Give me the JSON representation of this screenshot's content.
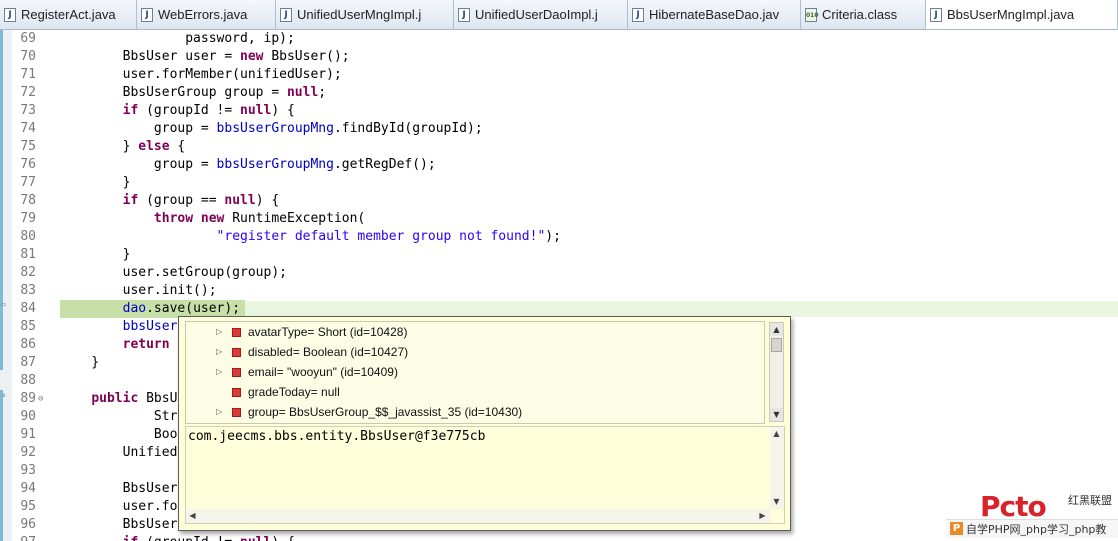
{
  "tabs": [
    {
      "label": "RegisterAct.java",
      "icon": "J",
      "active": false
    },
    {
      "label": "WebErrors.java",
      "icon": "J",
      "active": false
    },
    {
      "label": "UnifiedUserMngImpl.j",
      "icon": "J",
      "active": false
    },
    {
      "label": "UnifiedUserDaoImpl.j",
      "icon": "J",
      "active": false
    },
    {
      "label": "HibernateBaseDao.jav",
      "icon": "J",
      "active": false
    },
    {
      "label": "Criteria.class",
      "icon": "010",
      "active": false
    },
    {
      "label": "BbsUserMngImpl.java",
      "icon": "J",
      "active": true
    }
  ],
  "code_lines": [
    {
      "num": "69",
      "text": "                password, ip);"
    },
    {
      "num": "70",
      "text": "        BbsUser user = new BbsUser();"
    },
    {
      "num": "71",
      "text": "        user.forMember(unifiedUser);"
    },
    {
      "num": "72",
      "text": "        BbsUserGroup group = null;"
    },
    {
      "num": "73",
      "text": "        if (groupId != null) {"
    },
    {
      "num": "74",
      "text": "            group = bbsUserGroupMng.findById(groupId);"
    },
    {
      "num": "75",
      "text": "        } else {"
    },
    {
      "num": "76",
      "text": "            group = bbsUserGroupMng.getRegDef();"
    },
    {
      "num": "77",
      "text": "        }"
    },
    {
      "num": "78",
      "text": "        if (group == null) {"
    },
    {
      "num": "79",
      "text": "            throw new RuntimeException("
    },
    {
      "num": "80",
      "text": "                    \"register default member group not found!\");"
    },
    {
      "num": "81",
      "text": "        }"
    },
    {
      "num": "82",
      "text": "        user.setGroup(group);"
    },
    {
      "num": "83",
      "text": "        user.init();"
    },
    {
      "num": "84",
      "text": "        dao.save(user);"
    },
    {
      "num": "85",
      "text": "        bbsUserEn"
    },
    {
      "num": "86",
      "text": "        return u"
    },
    {
      "num": "87",
      "text": "    }"
    },
    {
      "num": "88",
      "text": ""
    },
    {
      "num": "89",
      "text": "    public BbsUse"
    },
    {
      "num": "90",
      "text": "            Stri"
    },
    {
      "num": "91",
      "text": "            Boole"
    },
    {
      "num": "92",
      "text": "        UnifiedU"
    },
    {
      "num": "93",
      "text": "                "
    },
    {
      "num": "94",
      "text": "        BbsUser "
    },
    {
      "num": "95",
      "text": "        user.for"
    },
    {
      "num": "96",
      "text": "        BbsUserG"
    },
    {
      "num": "97",
      "text": "        if (groupId != null) {"
    }
  ],
  "popup": {
    "variables": [
      {
        "label": "avatarType= Short  (id=10428)",
        "expandable": true
      },
      {
        "label": "disabled= Boolean  (id=10427)",
        "expandable": true
      },
      {
        "label": "email= \"wooyun\" (id=10409)",
        "expandable": true
      },
      {
        "label": "gradeToday= null",
        "expandable": false
      },
      {
        "label": "group= BbsUserGroup_$$_javassist_35  (id=10430)",
        "expandable": true
      }
    ],
    "detail_text": "com.jeecms.bbs.entity.BbsUser@f3e775cb"
  },
  "watermark": {
    "logo": "Pcto",
    "side": "红黑联盟",
    "bar": "自学PHP网_php学习_php教",
    "badge": "P"
  },
  "colors": {
    "keyword": "#7f0055",
    "field": "#0000c0",
    "string": "#2a00ff",
    "current_line": "#c7e0a8",
    "popup_bg": "#fefed8"
  }
}
